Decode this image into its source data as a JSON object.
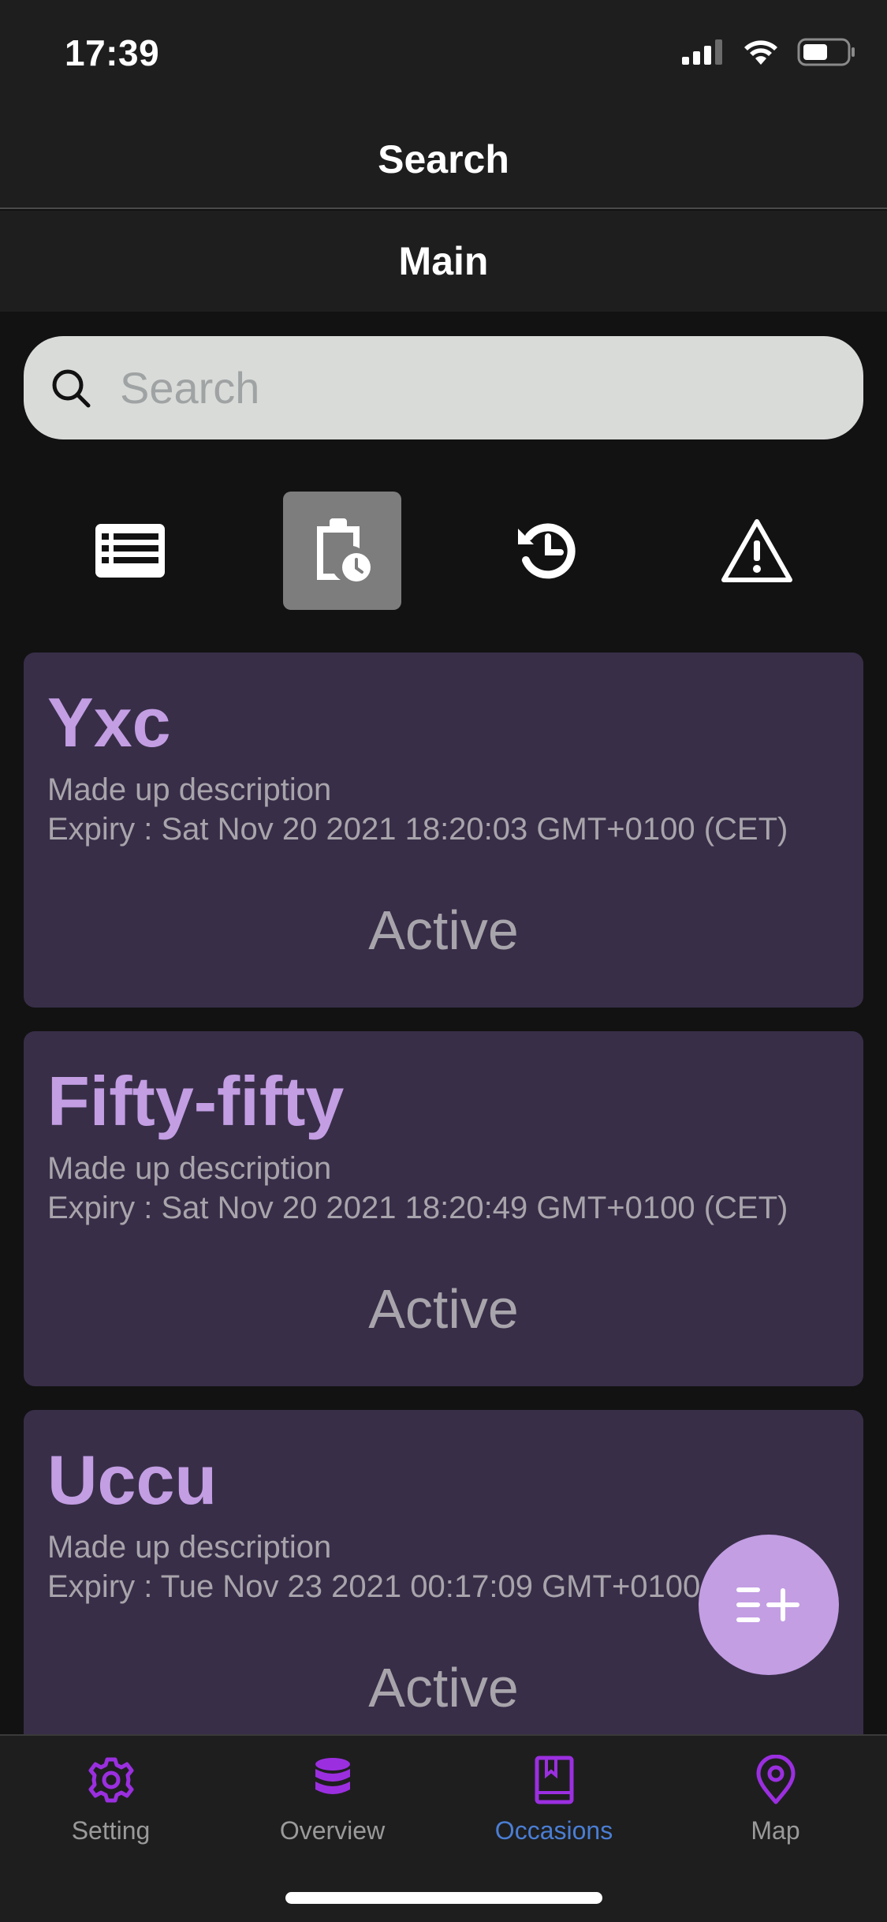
{
  "status_bar": {
    "time": "17:39"
  },
  "header": {
    "title": "Search"
  },
  "subheader": {
    "title": "Main"
  },
  "search": {
    "placeholder": "Search",
    "value": ""
  },
  "filters": [
    {
      "name": "list",
      "icon": "list-icon",
      "active": false
    },
    {
      "name": "scheduled",
      "icon": "clipboard-clock-icon",
      "active": true
    },
    {
      "name": "history",
      "icon": "history-icon",
      "active": false
    },
    {
      "name": "warning",
      "icon": "warning-icon",
      "active": false
    }
  ],
  "cards": [
    {
      "title": "Yxc",
      "description": "Made up description",
      "expiry": "Expiry : Sat Nov 20 2021 18:20:03 GMT+0100 (CET)",
      "status": "Active"
    },
    {
      "title": "Fifty-fifty",
      "description": "Made up description",
      "expiry": "Expiry : Sat Nov 20 2021 18:20:49 GMT+0100 (CET)",
      "status": "Active"
    },
    {
      "title": "Uccu",
      "description": "Made up description",
      "expiry": "Expiry : Tue Nov 23 2021 00:17:09 GMT+0100 (CET)",
      "status": "Active"
    }
  ],
  "fab": {
    "icon": "add-list-icon"
  },
  "bottom_nav": [
    {
      "label": "Setting",
      "icon": "gear-icon",
      "active": false
    },
    {
      "label": "Overview",
      "icon": "database-icon",
      "active": false
    },
    {
      "label": "Occasions",
      "icon": "book-icon",
      "active": true
    },
    {
      "label": "Map",
      "icon": "map-pin-icon",
      "active": false
    }
  ],
  "colors": {
    "accent": "#c39ee3",
    "nav_icon": "#9b2fe0",
    "nav_active_label": "#4a7ed4",
    "card_bg": "#382e48"
  }
}
